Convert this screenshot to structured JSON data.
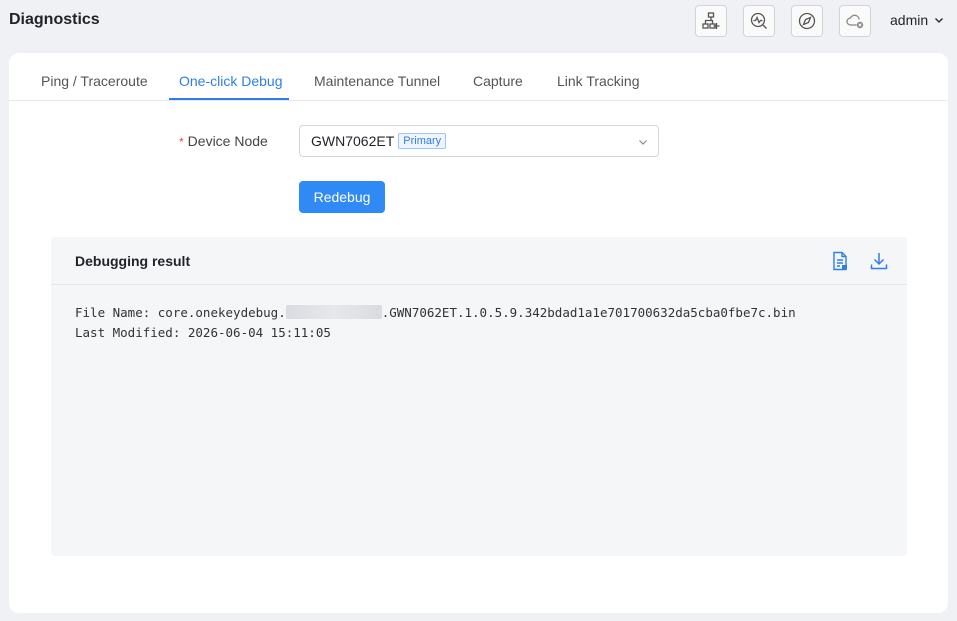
{
  "header": {
    "title": "Diagnostics",
    "user": "admin",
    "buttons": [
      {
        "icon": "network-add-icon"
      },
      {
        "icon": "speed-test-icon"
      },
      {
        "icon": "compass-icon"
      },
      {
        "icon": "cloud-disconnected-icon"
      }
    ]
  },
  "tabs": [
    {
      "label": "Ping / Traceroute"
    },
    {
      "label": "One-click Debug",
      "active": true
    },
    {
      "label": "Maintenance Tunnel"
    },
    {
      "label": "Capture"
    },
    {
      "label": "Link Tracking"
    }
  ],
  "form": {
    "required_mark": "*",
    "device_label": "Device Node",
    "device_value": "GWN7062ET",
    "device_badge": "Primary",
    "redebug_label": "Redebug"
  },
  "result": {
    "title": "Debugging result",
    "file_name_prefix": "File Name: core.onekeydebug.",
    "file_name_suffix": ".GWN7062ET.1.0.5.9.342bdad1a1e701700632da5cba0fbe7c.bin",
    "last_modified": "Last Modified: 2026-06-04 15:11:05"
  },
  "colors": {
    "accent": "#2f7ee8",
    "primary_button": "#2f8af5",
    "required": "#e5484d"
  }
}
